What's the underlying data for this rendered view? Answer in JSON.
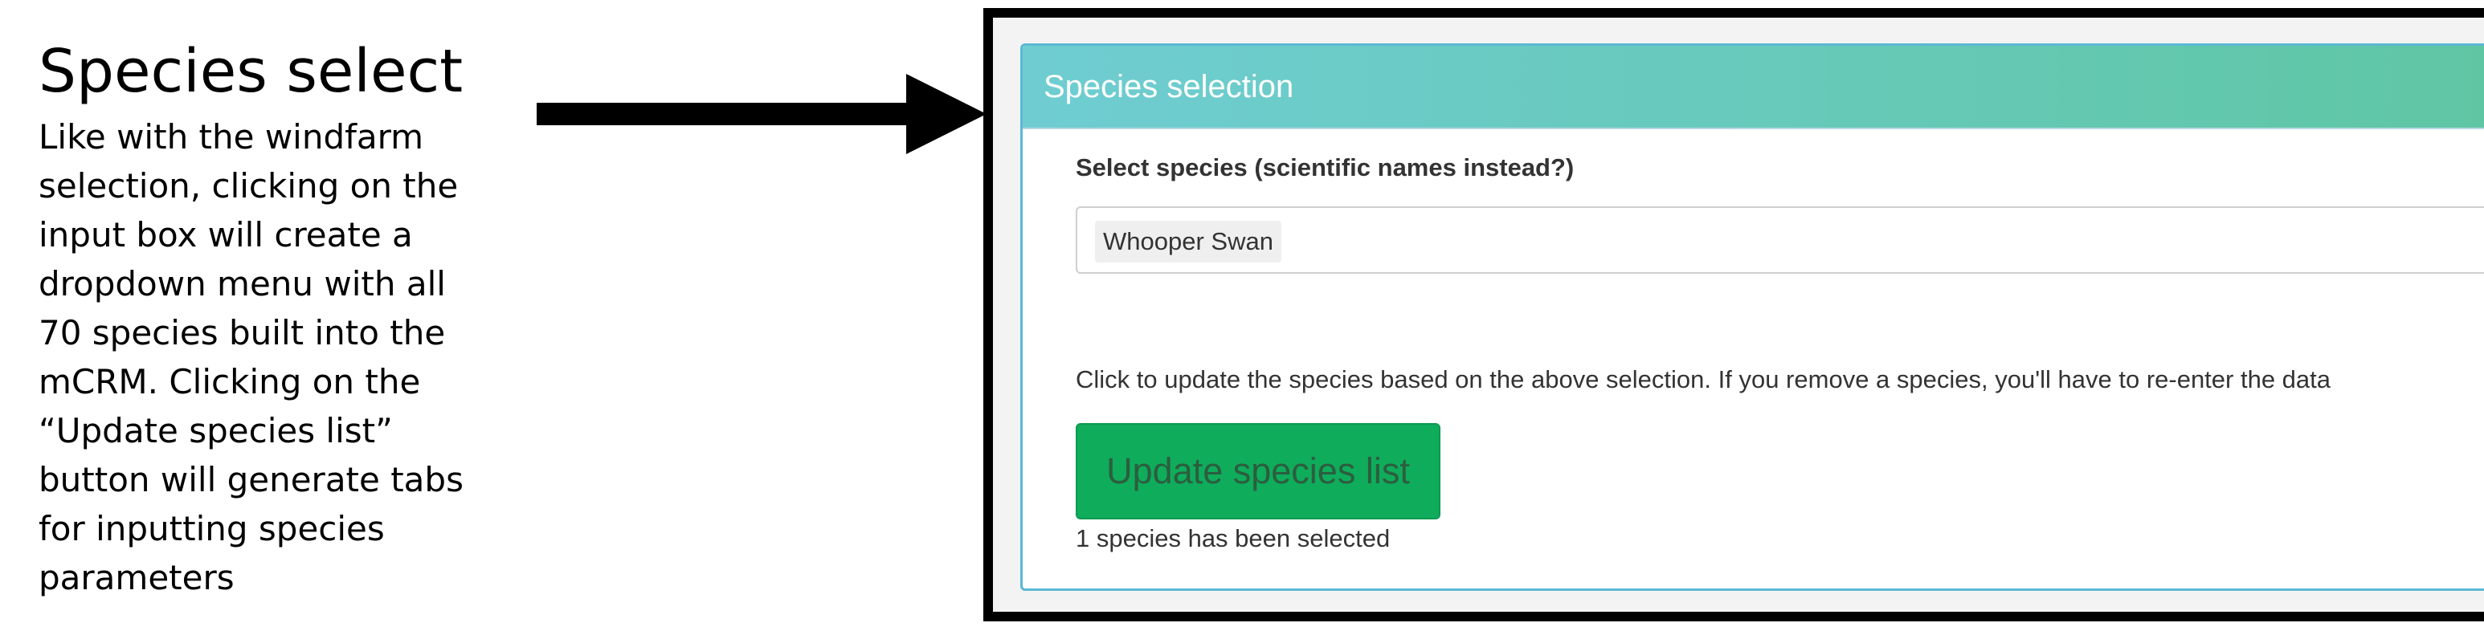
{
  "annotation": {
    "title": "Species select",
    "body": "Like with the windfarm selection, clicking on the input box will create a dropdown menu with all 70 species built into the mCRM. Clicking on the “Update species list” button will generate tabs for inputting species parameters"
  },
  "panel": {
    "title": "Species selection",
    "field_label": "Select species (scientific names instead?)",
    "selected_species": [
      "Whooper Swan"
    ],
    "help_text": "Click to update the species based on the above selection. If you remove a species, you'll have to re-enter the data",
    "update_button_label": "Update species list",
    "status_text": "1 species has been selected"
  },
  "colors": {
    "header_start": "#6fcdd2",
    "header_end": "#5fc6a3",
    "button": "#0fac5c",
    "panel_border": "#5bb8d4"
  },
  "icons": {
    "pointer": "right-arrow-icon"
  }
}
